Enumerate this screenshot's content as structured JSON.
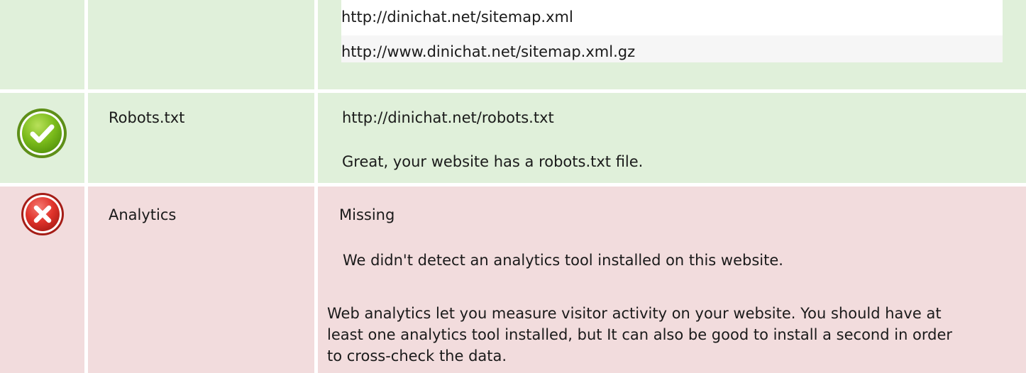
{
  "sitemap": {
    "urls": [
      "http://dinichat.net/sitemap.xml",
      "http://www.dinichat.net/sitemap.xml.gz"
    ],
    "status_color": "#e0f0da"
  },
  "robots": {
    "label": "Robots.txt",
    "url": "http://dinichat.net/robots.txt",
    "message": "Great, your website has a robots.txt file.",
    "status": "pass",
    "status_icon": "check-icon",
    "status_color": "#e0f0da"
  },
  "analytics": {
    "label": "Analytics",
    "status_text": "Missing",
    "message": "We didn't detect an analytics tool installed on this website.",
    "description": "Web analytics let you measure visitor activity on your website. You should have at least one analytics tool installed, but It can also be good to install a second in order to cross-check the data.",
    "status": "fail",
    "status_icon": "cross-icon",
    "status_color": "#f2dcdd"
  }
}
